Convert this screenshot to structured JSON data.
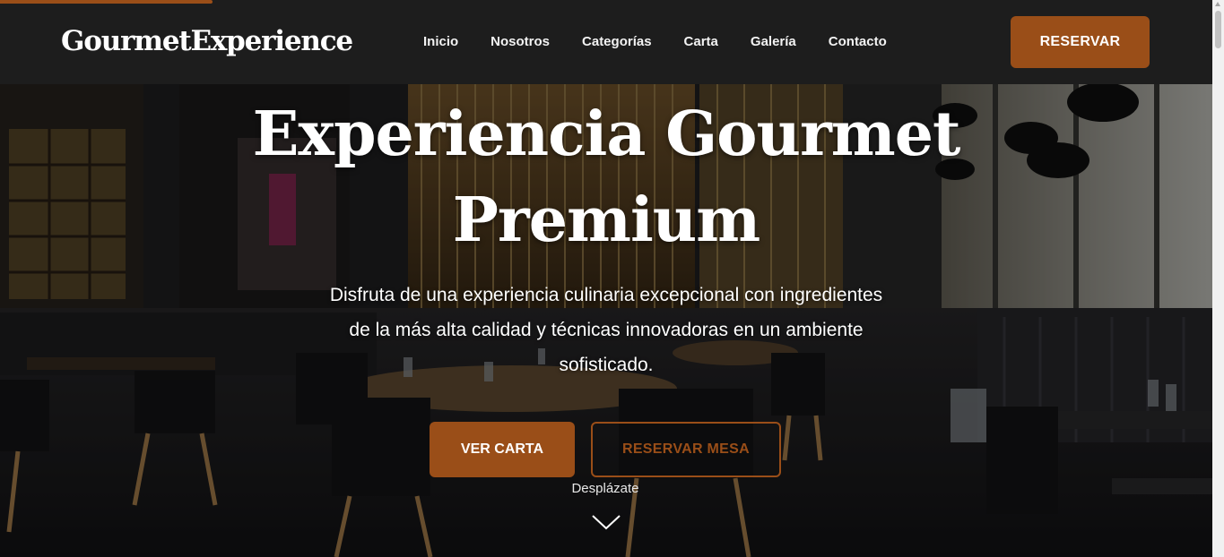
{
  "header": {
    "logo": "GourmetExperience",
    "nav": [
      {
        "label": "Inicio"
      },
      {
        "label": "Nosotros"
      },
      {
        "label": "Categorías"
      },
      {
        "label": "Carta"
      },
      {
        "label": "Galería"
      },
      {
        "label": "Contacto"
      }
    ],
    "reserve_label": "RESERVAR"
  },
  "hero": {
    "title_line1": "Experiencia Gourmet",
    "title_line2": "Premium",
    "subtitle_line1": "Disfruta de una experiencia culinaria excepcional con ingredientes",
    "subtitle_line2": "de la más alta calidad y técnicas innovadoras en un ambiente",
    "subtitle_line3": "sofisticado.",
    "primary_button": "VER CARTA",
    "secondary_button": "RESERVAR MESA",
    "scroll_label": "Desplázate",
    "scroll_icon": "chevron-down-icon"
  },
  "colors": {
    "accent": "#9a4e18",
    "header_bg": "#1d1d1d",
    "text": "#ffffff"
  }
}
